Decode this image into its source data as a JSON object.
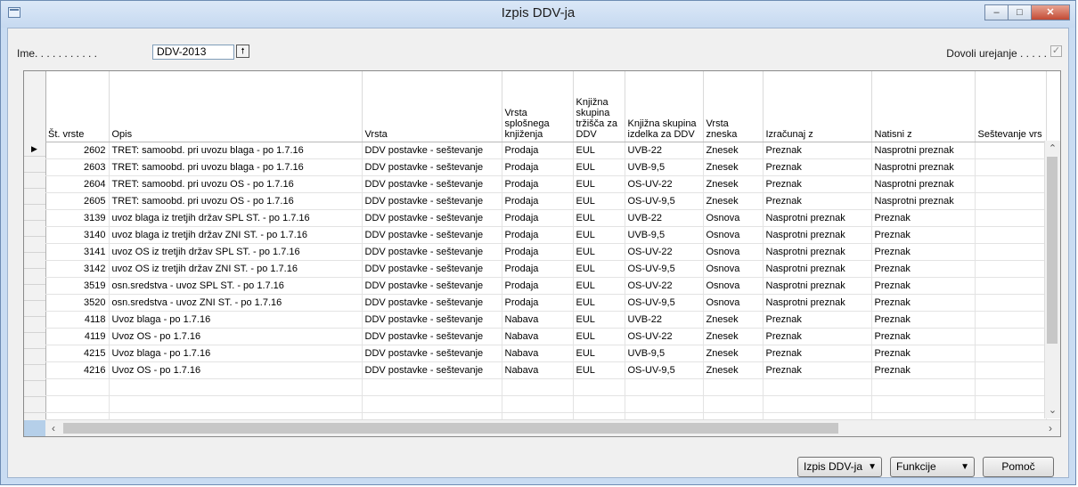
{
  "window": {
    "title": "Izpis DDV-ja"
  },
  "header": {
    "name_label": "Ime. . . . . . . . . . .",
    "name_value": "DDV-2013",
    "allow_edit_label": "Dovoli urejanje . . . . .",
    "allow_edit_checked": true
  },
  "table": {
    "columns": [
      "Št. vrste",
      "Opis",
      "Vrsta",
      "Vrsta splošnega knjiženja",
      "Knjižna skupina tržišča za DDV",
      "Knjižna skupina izdelka za DDV",
      "Vrsta zneska",
      "Izračunaj z",
      "Natisni z",
      "Seštevanje vrs"
    ],
    "rows": [
      [
        "2602",
        "TRET: samoobd. pri uvozu blaga - po 1.7.16",
        "DDV postavke - seštevanje",
        "Prodaja",
        "EUL",
        "UVB-22",
        "Znesek",
        "Preznak",
        "Nasprotni preznak"
      ],
      [
        "2603",
        "TRET: samoobd. pri uvozu blaga - po 1.7.16",
        "DDV postavke - seštevanje",
        "Prodaja",
        "EUL",
        "UVB-9,5",
        "Znesek",
        "Preznak",
        "Nasprotni preznak"
      ],
      [
        "2604",
        "TRET: samoobd. pri uvozu OS - po 1.7.16",
        "DDV postavke - seštevanje",
        "Prodaja",
        "EUL",
        "OS-UV-22",
        "Znesek",
        "Preznak",
        "Nasprotni preznak"
      ],
      [
        "2605",
        "TRET: samoobd. pri uvozu OS - po 1.7.16",
        "DDV postavke - seštevanje",
        "Prodaja",
        "EUL",
        "OS-UV-9,5",
        "Znesek",
        "Preznak",
        "Nasprotni preznak"
      ],
      [
        "3139",
        "uvoz blaga iz tretjih držav SPL ST. - po 1.7.16",
        "DDV postavke - seštevanje",
        "Prodaja",
        "EUL",
        "UVB-22",
        "Osnova",
        "Nasprotni preznak",
        "Preznak"
      ],
      [
        "3140",
        "uvoz blaga iz tretjih držav ZNI ST. - po 1.7.16",
        "DDV postavke - seštevanje",
        "Prodaja",
        "EUL",
        "UVB-9,5",
        "Osnova",
        "Nasprotni preznak",
        "Preznak"
      ],
      [
        "3141",
        "uvoz OS iz tretjih držav SPL ST. - po 1.7.16",
        "DDV postavke - seštevanje",
        "Prodaja",
        "EUL",
        "OS-UV-22",
        "Osnova",
        "Nasprotni preznak",
        "Preznak"
      ],
      [
        "3142",
        "uvoz OS iz tretjih držav ZNI ST. - po 1.7.16",
        "DDV postavke - seštevanje",
        "Prodaja",
        "EUL",
        "OS-UV-9,5",
        "Osnova",
        "Nasprotni preznak",
        "Preznak"
      ],
      [
        "3519",
        "osn.sredstva - uvoz SPL ST. - po 1.7.16",
        "DDV postavke - seštevanje",
        "Prodaja",
        "EUL",
        "OS-UV-22",
        "Osnova",
        "Nasprotni preznak",
        "Preznak"
      ],
      [
        "3520",
        "osn.sredstva - uvoz ZNI ST. - po 1.7.16",
        "DDV postavke - seštevanje",
        "Prodaja",
        "EUL",
        "OS-UV-9,5",
        "Osnova",
        "Nasprotni preznak",
        "Preznak"
      ],
      [
        "4118",
        "Uvoz blaga - po 1.7.16",
        "DDV postavke - seštevanje",
        "Nabava",
        "EUL",
        "UVB-22",
        "Znesek",
        "Preznak",
        "Preznak"
      ],
      [
        "4119",
        "Uvoz OS - po 1.7.16",
        "DDV postavke - seštevanje",
        "Nabava",
        "EUL",
        "OS-UV-22",
        "Znesek",
        "Preznak",
        "Preznak"
      ],
      [
        "4215",
        "Uvoz blaga - po 1.7.16",
        "DDV postavke - seštevanje",
        "Nabava",
        "EUL",
        "UVB-9,5",
        "Znesek",
        "Preznak",
        "Preznak"
      ],
      [
        "4216",
        "Uvoz OS - po 1.7.16",
        "DDV postavke - seštevanje",
        "Nabava",
        "EUL",
        "OS-UV-9,5",
        "Znesek",
        "Preznak",
        "Preznak"
      ]
    ]
  },
  "footer": {
    "izpis_label": "Izpis DDV-ja",
    "funkcije_label": "Funkcije",
    "pomoc_label": "Pomoč"
  }
}
